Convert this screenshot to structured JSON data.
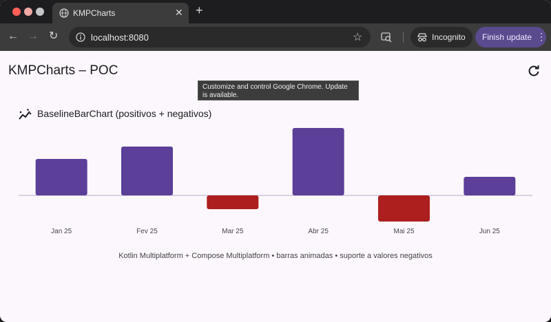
{
  "browser": {
    "tab_title": "KMPCharts",
    "url": "localhost:8080",
    "incognito_label": "Incognito",
    "update_label": "Finish update",
    "tooltip": "Customize and control Google Chrome. Update is available."
  },
  "app": {
    "title": "KMPCharts – POC"
  },
  "chart_data": {
    "type": "bar",
    "title": "BaselineBarChart (positivos + negativos)",
    "categories": [
      "Jan 25",
      "Fev 25",
      "Mar 25",
      "Abr 25",
      "Mai 25",
      "Jun 25"
    ],
    "values": [
      53,
      71,
      -20,
      98,
      -38,
      27
    ],
    "ylim": [
      -40,
      100
    ],
    "colors": {
      "positive": "#5b3f99",
      "negative": "#ad1f1f",
      "baseline": "#b8aec6"
    }
  },
  "footer": "Kotlin Multiplatform + Compose Multiplatform • barras animadas • suporte a valores negativos"
}
